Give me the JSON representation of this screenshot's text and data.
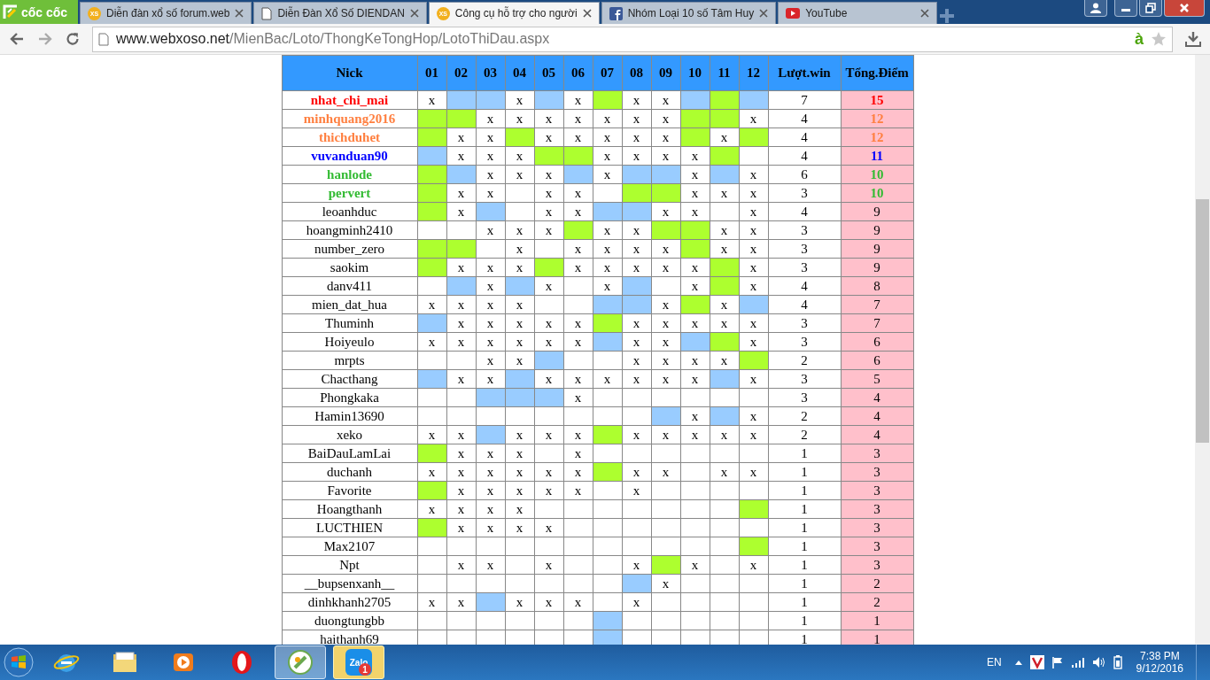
{
  "browser": {
    "brand": "cốc cốc",
    "tabs": [
      {
        "title": "Diễn đàn xổ số forum.web",
        "kind": "xs",
        "icon_text": "XS",
        "selected": false
      },
      {
        "title": "Diễn Đàn Xổ Số DIENDAN",
        "kind": "page",
        "selected": false
      },
      {
        "title": "Công cụ hỗ trợ cho người",
        "kind": "xs",
        "icon_text": "XS",
        "selected": true
      },
      {
        "title": "Nhóm Loại 10 số Tâm Huy",
        "kind": "facebook",
        "selected": false
      },
      {
        "title": "YouTube",
        "kind": "youtube",
        "selected": false
      }
    ],
    "url_host": "www.webxoso.net",
    "url_path": "/MienBac/Loto/ThongKeTongHop/LotoThiDau.aspx",
    "omnibox_mark": "à"
  },
  "table": {
    "columns": [
      "Nick",
      "01",
      "02",
      "03",
      "04",
      "05",
      "06",
      "07",
      "08",
      "09",
      "10",
      "11",
      "12",
      "Lượt.win",
      "Tổng.Điểm"
    ],
    "rows": [
      {
        "cells": [
          {
            "kind": "nick",
            "text": "nhat_chi_mai",
            "color": "#ff0000"
          },
          {
            "kind": "mark",
            "text": "x"
          },
          {
            "kind": "fill",
            "color": "#99ccff"
          },
          {
            "kind": "fill",
            "color": "#99ccff"
          },
          {
            "kind": "mark",
            "text": "x"
          },
          {
            "kind": "fill",
            "color": "#99ccff"
          },
          {
            "kind": "mark",
            "text": "x"
          },
          {
            "kind": "fill",
            "color": "#adff2f"
          },
          {
            "kind": "mark",
            "text": "x"
          },
          {
            "kind": "mark",
            "text": "x"
          },
          {
            "kind": "fill",
            "color": "#99ccff"
          },
          {
            "kind": "fill",
            "color": "#adff2f"
          },
          {
            "kind": "fill",
            "color": "#99ccff"
          },
          {
            "kind": "wins",
            "text": "7"
          },
          {
            "kind": "points",
            "text": "15",
            "color": "#ff0000"
          }
        ]
      },
      {
        "cells": [
          {
            "kind": "nick",
            "text": "minhquang2016",
            "color": "#ff7f3f"
          },
          {
            "kind": "fill",
            "color": "#adff2f"
          },
          {
            "kind": "fill",
            "color": "#adff2f"
          },
          {
            "kind": "mark",
            "text": "x"
          },
          {
            "kind": "mark",
            "text": "x"
          },
          {
            "kind": "mark",
            "text": "x"
          },
          {
            "kind": "mark",
            "text": "x"
          },
          {
            "kind": "mark",
            "text": "x"
          },
          {
            "kind": "mark",
            "text": "x"
          },
          {
            "kind": "mark",
            "text": "x"
          },
          {
            "kind": "fill",
            "color": "#adff2f"
          },
          {
            "kind": "fill",
            "color": "#adff2f"
          },
          {
            "kind": "mark",
            "text": "x"
          },
          {
            "kind": "wins",
            "text": "4"
          },
          {
            "kind": "points",
            "text": "12",
            "color": "#ff7f3f"
          }
        ]
      },
      {
        "cells": [
          {
            "kind": "nick",
            "text": "thichduhet",
            "color": "#ff7f3f"
          },
          {
            "kind": "fill",
            "color": "#adff2f"
          },
          {
            "kind": "mark",
            "text": "x"
          },
          {
            "kind": "mark",
            "text": "x"
          },
          {
            "kind": "fill",
            "color": "#adff2f"
          },
          {
            "kind": "mark",
            "text": "x"
          },
          {
            "kind": "mark",
            "text": "x"
          },
          {
            "kind": "mark",
            "text": "x"
          },
          {
            "kind": "mark",
            "text": "x"
          },
          {
            "kind": "mark",
            "text": "x"
          },
          {
            "kind": "fill",
            "color": "#adff2f"
          },
          {
            "kind": "mark",
            "text": "x"
          },
          {
            "kind": "fill",
            "color": "#adff2f"
          },
          {
            "kind": "wins",
            "text": "4"
          },
          {
            "kind": "points",
            "text": "12",
            "color": "#ff7f3f"
          }
        ]
      },
      {
        "cells": [
          {
            "kind": "nick",
            "text": "vuvanduan90",
            "color": "#0000ff"
          },
          {
            "kind": "fill",
            "color": "#99ccff"
          },
          {
            "kind": "mark",
            "text": "x"
          },
          {
            "kind": "mark",
            "text": "x"
          },
          {
            "kind": "mark",
            "text": "x"
          },
          {
            "kind": "fill",
            "color": "#adff2f"
          },
          {
            "kind": "fill",
            "color": "#adff2f"
          },
          {
            "kind": "mark",
            "text": "x"
          },
          {
            "kind": "mark",
            "text": "x"
          },
          {
            "kind": "mark",
            "text": "x"
          },
          {
            "kind": "mark",
            "text": "x"
          },
          {
            "kind": "fill",
            "color": "#adff2f"
          },
          {
            "kind": "empty"
          },
          {
            "kind": "wins",
            "text": "4"
          },
          {
            "kind": "points",
            "text": "11",
            "color": "#0000ff"
          }
        ]
      },
      {
        "cells": [
          {
            "kind": "nick",
            "text": "hanlode",
            "color": "#33bb33"
          },
          {
            "kind": "fill",
            "color": "#adff2f"
          },
          {
            "kind": "fill",
            "color": "#99ccff"
          },
          {
            "kind": "mark",
            "text": "x"
          },
          {
            "kind": "mark",
            "text": "x"
          },
          {
            "kind": "mark",
            "text": "x"
          },
          {
            "kind": "fill",
            "color": "#99ccff"
          },
          {
            "kind": "mark",
            "text": "x"
          },
          {
            "kind": "fill",
            "color": "#99ccff"
          },
          {
            "kind": "fill",
            "color": "#99ccff"
          },
          {
            "kind": "mark",
            "text": "x"
          },
          {
            "kind": "fill",
            "color": "#99ccff"
          },
          {
            "kind": "mark",
            "text": "x"
          },
          {
            "kind": "wins",
            "text": "6"
          },
          {
            "kind": "points",
            "text": "10",
            "color": "#33bb33"
          }
        ]
      },
      {
        "cells": [
          {
            "kind": "nick",
            "text": "pervert",
            "color": "#33bb33"
          },
          {
            "kind": "fill",
            "color": "#adff2f"
          },
          {
            "kind": "mark",
            "text": "x"
          },
          {
            "kind": "mark",
            "text": "x"
          },
          {
            "kind": "empty"
          },
          {
            "kind": "mark",
            "text": "x"
          },
          {
            "kind": "mark",
            "text": "x"
          },
          {
            "kind": "empty"
          },
          {
            "kind": "fill",
            "color": "#adff2f"
          },
          {
            "kind": "fill",
            "color": "#adff2f"
          },
          {
            "kind": "mark",
            "text": "x"
          },
          {
            "kind": "mark",
            "text": "x"
          },
          {
            "kind": "mark",
            "text": "x"
          },
          {
            "kind": "wins",
            "text": "3"
          },
          {
            "kind": "points",
            "text": "10",
            "color": "#33bb33"
          }
        ]
      },
      {
        "cells": [
          {
            "kind": "nick",
            "text": "leoanhduc"
          },
          {
            "kind": "fill",
            "color": "#adff2f"
          },
          {
            "kind": "mark",
            "text": "x"
          },
          {
            "kind": "fill",
            "color": "#99ccff"
          },
          {
            "kind": "empty"
          },
          {
            "kind": "mark",
            "text": "x"
          },
          {
            "kind": "mark",
            "text": "x"
          },
          {
            "kind": "fill",
            "color": "#99ccff"
          },
          {
            "kind": "fill",
            "color": "#99ccff"
          },
          {
            "kind": "mark",
            "text": "x"
          },
          {
            "kind": "mark",
            "text": "x"
          },
          {
            "kind": "empty"
          },
          {
            "kind": "mark",
            "text": "x"
          },
          {
            "kind": "wins",
            "text": "4"
          },
          {
            "kind": "points",
            "text": "9"
          }
        ]
      },
      {
        "cells": [
          {
            "kind": "nick",
            "text": "hoangminh2410"
          },
          {
            "kind": "empty"
          },
          {
            "kind": "empty"
          },
          {
            "kind": "mark",
            "text": "x"
          },
          {
            "kind": "mark",
            "text": "x"
          },
          {
            "kind": "mark",
            "text": "x"
          },
          {
            "kind": "fill",
            "color": "#adff2f"
          },
          {
            "kind": "mark",
            "text": "x"
          },
          {
            "kind": "mark",
            "text": "x"
          },
          {
            "kind": "fill",
            "color": "#adff2f"
          },
          {
            "kind": "fill",
            "color": "#adff2f"
          },
          {
            "kind": "mark",
            "text": "x"
          },
          {
            "kind": "mark",
            "text": "x"
          },
          {
            "kind": "wins",
            "text": "3"
          },
          {
            "kind": "points",
            "text": "9"
          }
        ]
      },
      {
        "cells": [
          {
            "kind": "nick",
            "text": "number_zero"
          },
          {
            "kind": "fill",
            "color": "#adff2f"
          },
          {
            "kind": "fill",
            "color": "#adff2f"
          },
          {
            "kind": "empty"
          },
          {
            "kind": "mark",
            "text": "x"
          },
          {
            "kind": "empty"
          },
          {
            "kind": "mark",
            "text": "x"
          },
          {
            "kind": "mark",
            "text": "x"
          },
          {
            "kind": "mark",
            "text": "x"
          },
          {
            "kind": "mark",
            "text": "x"
          },
          {
            "kind": "fill",
            "color": "#adff2f"
          },
          {
            "kind": "mark",
            "text": "x"
          },
          {
            "kind": "mark",
            "text": "x"
          },
          {
            "kind": "wins",
            "text": "3"
          },
          {
            "kind": "points",
            "text": "9"
          }
        ]
      },
      {
        "cells": [
          {
            "kind": "nick",
            "text": "saokim"
          },
          {
            "kind": "fill",
            "color": "#adff2f"
          },
          {
            "kind": "mark",
            "text": "x"
          },
          {
            "kind": "mark",
            "text": "x"
          },
          {
            "kind": "mark",
            "text": "x"
          },
          {
            "kind": "fill",
            "color": "#adff2f"
          },
          {
            "kind": "mark",
            "text": "x"
          },
          {
            "kind": "mark",
            "text": "x"
          },
          {
            "kind": "mark",
            "text": "x"
          },
          {
            "kind": "mark",
            "text": "x"
          },
          {
            "kind": "mark",
            "text": "x"
          },
          {
            "kind": "fill",
            "color": "#adff2f"
          },
          {
            "kind": "mark",
            "text": "x"
          },
          {
            "kind": "wins",
            "text": "3"
          },
          {
            "kind": "points",
            "text": "9"
          }
        ]
      },
      {
        "cells": [
          {
            "kind": "nick",
            "text": "danv411"
          },
          {
            "kind": "empty"
          },
          {
            "kind": "fill",
            "color": "#99ccff"
          },
          {
            "kind": "mark",
            "text": "x"
          },
          {
            "kind": "fill",
            "color": "#99ccff"
          },
          {
            "kind": "mark",
            "text": "x"
          },
          {
            "kind": "empty"
          },
          {
            "kind": "mark",
            "text": "x"
          },
          {
            "kind": "fill",
            "color": "#99ccff"
          },
          {
            "kind": "empty"
          },
          {
            "kind": "mark",
            "text": "x"
          },
          {
            "kind": "fill",
            "color": "#adff2f"
          },
          {
            "kind": "mark",
            "text": "x"
          },
          {
            "kind": "wins",
            "text": "4"
          },
          {
            "kind": "points",
            "text": "8"
          }
        ]
      },
      {
        "cells": [
          {
            "kind": "nick",
            "text": "mien_dat_hua"
          },
          {
            "kind": "mark",
            "text": "x"
          },
          {
            "kind": "mark",
            "text": "x"
          },
          {
            "kind": "mark",
            "text": "x"
          },
          {
            "kind": "mark",
            "text": "x"
          },
          {
            "kind": "empty"
          },
          {
            "kind": "empty"
          },
          {
            "kind": "fill",
            "color": "#99ccff"
          },
          {
            "kind": "fill",
            "color": "#99ccff"
          },
          {
            "kind": "mark",
            "text": "x"
          },
          {
            "kind": "fill",
            "color": "#adff2f"
          },
          {
            "kind": "mark",
            "text": "x"
          },
          {
            "kind": "fill",
            "color": "#99ccff"
          },
          {
            "kind": "wins",
            "text": "4"
          },
          {
            "kind": "points",
            "text": "7"
          }
        ]
      },
      {
        "cells": [
          {
            "kind": "nick",
            "text": "Thuminh"
          },
          {
            "kind": "fill",
            "color": "#99ccff"
          },
          {
            "kind": "mark",
            "text": "x"
          },
          {
            "kind": "mark",
            "text": "x"
          },
          {
            "kind": "mark",
            "text": "x"
          },
          {
            "kind": "mark",
            "text": "x"
          },
          {
            "kind": "mark",
            "text": "x"
          },
          {
            "kind": "fill",
            "color": "#adff2f"
          },
          {
            "kind": "mark",
            "text": "x"
          },
          {
            "kind": "mark",
            "text": "x"
          },
          {
            "kind": "mark",
            "text": "x"
          },
          {
            "kind": "mark",
            "text": "x"
          },
          {
            "kind": "mark",
            "text": "x"
          },
          {
            "kind": "wins",
            "text": "3"
          },
          {
            "kind": "points",
            "text": "7"
          }
        ]
      },
      {
        "cells": [
          {
            "kind": "nick",
            "text": "Hoiyeulo"
          },
          {
            "kind": "mark",
            "text": "x"
          },
          {
            "kind": "mark",
            "text": "x"
          },
          {
            "kind": "mark",
            "text": "x"
          },
          {
            "kind": "mark",
            "text": "x"
          },
          {
            "kind": "mark",
            "text": "x"
          },
          {
            "kind": "mark",
            "text": "x"
          },
          {
            "kind": "fill",
            "color": "#99ccff"
          },
          {
            "kind": "mark",
            "text": "x"
          },
          {
            "kind": "mark",
            "text": "x"
          },
          {
            "kind": "fill",
            "color": "#99ccff"
          },
          {
            "kind": "fill",
            "color": "#adff2f"
          },
          {
            "kind": "mark",
            "text": "x"
          },
          {
            "kind": "wins",
            "text": "3"
          },
          {
            "kind": "points",
            "text": "6"
          }
        ]
      },
      {
        "cells": [
          {
            "kind": "nick",
            "text": "mrpts"
          },
          {
            "kind": "empty"
          },
          {
            "kind": "empty"
          },
          {
            "kind": "mark",
            "text": "x"
          },
          {
            "kind": "mark",
            "text": "x"
          },
          {
            "kind": "fill",
            "color": "#99ccff"
          },
          {
            "kind": "empty"
          },
          {
            "kind": "empty"
          },
          {
            "kind": "mark",
            "text": "x"
          },
          {
            "kind": "mark",
            "text": "x"
          },
          {
            "kind": "mark",
            "text": "x"
          },
          {
            "kind": "mark",
            "text": "x"
          },
          {
            "kind": "fill",
            "color": "#adff2f"
          },
          {
            "kind": "wins",
            "text": "2"
          },
          {
            "kind": "points",
            "text": "6"
          }
        ]
      },
      {
        "cells": [
          {
            "kind": "nick",
            "text": "Chacthang"
          },
          {
            "kind": "fill",
            "color": "#99ccff"
          },
          {
            "kind": "mark",
            "text": "x"
          },
          {
            "kind": "mark",
            "text": "x"
          },
          {
            "kind": "fill",
            "color": "#99ccff"
          },
          {
            "kind": "mark",
            "text": "x"
          },
          {
            "kind": "mark",
            "text": "x"
          },
          {
            "kind": "mark",
            "text": "x"
          },
          {
            "kind": "mark",
            "text": "x"
          },
          {
            "kind": "mark",
            "text": "x"
          },
          {
            "kind": "mark",
            "text": "x"
          },
          {
            "kind": "fill",
            "color": "#99ccff"
          },
          {
            "kind": "mark",
            "text": "x"
          },
          {
            "kind": "wins",
            "text": "3"
          },
          {
            "kind": "points",
            "text": "5"
          }
        ]
      },
      {
        "cells": [
          {
            "kind": "nick",
            "text": "Phongkaka"
          },
          {
            "kind": "empty"
          },
          {
            "kind": "empty"
          },
          {
            "kind": "fill",
            "color": "#99ccff"
          },
          {
            "kind": "fill",
            "color": "#99ccff"
          },
          {
            "kind": "fill",
            "color": "#99ccff"
          },
          {
            "kind": "mark",
            "text": "x"
          },
          {
            "kind": "empty"
          },
          {
            "kind": "empty"
          },
          {
            "kind": "empty"
          },
          {
            "kind": "empty"
          },
          {
            "kind": "empty"
          },
          {
            "kind": "empty"
          },
          {
            "kind": "wins",
            "text": "3"
          },
          {
            "kind": "points",
            "text": "4"
          }
        ]
      },
      {
        "cells": [
          {
            "kind": "nick",
            "text": "Hamin13690"
          },
          {
            "kind": "empty"
          },
          {
            "kind": "empty"
          },
          {
            "kind": "empty"
          },
          {
            "kind": "empty"
          },
          {
            "kind": "empty"
          },
          {
            "kind": "empty"
          },
          {
            "kind": "empty"
          },
          {
            "kind": "empty"
          },
          {
            "kind": "fill",
            "color": "#99ccff"
          },
          {
            "kind": "mark",
            "text": "x"
          },
          {
            "kind": "fill",
            "color": "#99ccff"
          },
          {
            "kind": "mark",
            "text": "x"
          },
          {
            "kind": "wins",
            "text": "2"
          },
          {
            "kind": "points",
            "text": "4"
          }
        ]
      },
      {
        "cells": [
          {
            "kind": "nick",
            "text": "xeko"
          },
          {
            "kind": "mark",
            "text": "x"
          },
          {
            "kind": "mark",
            "text": "x"
          },
          {
            "kind": "fill",
            "color": "#99ccff"
          },
          {
            "kind": "mark",
            "text": "x"
          },
          {
            "kind": "mark",
            "text": "x"
          },
          {
            "kind": "mark",
            "text": "x"
          },
          {
            "kind": "fill",
            "color": "#adff2f"
          },
          {
            "kind": "mark",
            "text": "x"
          },
          {
            "kind": "mark",
            "text": "x"
          },
          {
            "kind": "mark",
            "text": "x"
          },
          {
            "kind": "mark",
            "text": "x"
          },
          {
            "kind": "mark",
            "text": "x"
          },
          {
            "kind": "wins",
            "text": "2"
          },
          {
            "kind": "points",
            "text": "4"
          }
        ]
      },
      {
        "cells": [
          {
            "kind": "nick",
            "text": "BaiDauLamLai"
          },
          {
            "kind": "fill",
            "color": "#adff2f"
          },
          {
            "kind": "mark",
            "text": "x"
          },
          {
            "kind": "mark",
            "text": "x"
          },
          {
            "kind": "mark",
            "text": "x"
          },
          {
            "kind": "empty"
          },
          {
            "kind": "mark",
            "text": "x"
          },
          {
            "kind": "empty"
          },
          {
            "kind": "empty"
          },
          {
            "kind": "empty"
          },
          {
            "kind": "empty"
          },
          {
            "kind": "empty"
          },
          {
            "kind": "empty"
          },
          {
            "kind": "wins",
            "text": "1"
          },
          {
            "kind": "points",
            "text": "3"
          }
        ]
      },
      {
        "cells": [
          {
            "kind": "nick",
            "text": "duchanh"
          },
          {
            "kind": "mark",
            "text": "x"
          },
          {
            "kind": "mark",
            "text": "x"
          },
          {
            "kind": "mark",
            "text": "x"
          },
          {
            "kind": "mark",
            "text": "x"
          },
          {
            "kind": "mark",
            "text": "x"
          },
          {
            "kind": "mark",
            "text": "x"
          },
          {
            "kind": "fill",
            "color": "#adff2f"
          },
          {
            "kind": "mark",
            "text": "x"
          },
          {
            "kind": "mark",
            "text": "x"
          },
          {
            "kind": "empty"
          },
          {
            "kind": "mark",
            "text": "x"
          },
          {
            "kind": "mark",
            "text": "x"
          },
          {
            "kind": "wins",
            "text": "1"
          },
          {
            "kind": "points",
            "text": "3"
          }
        ]
      },
      {
        "cells": [
          {
            "kind": "nick",
            "text": "Favorite"
          },
          {
            "kind": "fill",
            "color": "#adff2f"
          },
          {
            "kind": "mark",
            "text": "x"
          },
          {
            "kind": "mark",
            "text": "x"
          },
          {
            "kind": "mark",
            "text": "x"
          },
          {
            "kind": "mark",
            "text": "x"
          },
          {
            "kind": "mark",
            "text": "x"
          },
          {
            "kind": "empty"
          },
          {
            "kind": "mark",
            "text": "x"
          },
          {
            "kind": "empty"
          },
          {
            "kind": "empty"
          },
          {
            "kind": "empty"
          },
          {
            "kind": "empty"
          },
          {
            "kind": "wins",
            "text": "1"
          },
          {
            "kind": "points",
            "text": "3"
          }
        ]
      },
      {
        "cells": [
          {
            "kind": "nick",
            "text": "Hoangthanh"
          },
          {
            "kind": "mark",
            "text": "x"
          },
          {
            "kind": "mark",
            "text": "x"
          },
          {
            "kind": "mark",
            "text": "x"
          },
          {
            "kind": "mark",
            "text": "x"
          },
          {
            "kind": "empty"
          },
          {
            "kind": "empty"
          },
          {
            "kind": "empty"
          },
          {
            "kind": "empty"
          },
          {
            "kind": "empty"
          },
          {
            "kind": "empty"
          },
          {
            "kind": "empty"
          },
          {
            "kind": "fill",
            "color": "#adff2f"
          },
          {
            "kind": "wins",
            "text": "1"
          },
          {
            "kind": "points",
            "text": "3"
          }
        ]
      },
      {
        "cells": [
          {
            "kind": "nick",
            "text": "LUCTHIEN"
          },
          {
            "kind": "fill",
            "color": "#adff2f"
          },
          {
            "kind": "mark",
            "text": "x"
          },
          {
            "kind": "mark",
            "text": "x"
          },
          {
            "kind": "mark",
            "text": "x"
          },
          {
            "kind": "mark",
            "text": "x"
          },
          {
            "kind": "empty"
          },
          {
            "kind": "empty"
          },
          {
            "kind": "empty"
          },
          {
            "kind": "empty"
          },
          {
            "kind": "empty"
          },
          {
            "kind": "empty"
          },
          {
            "kind": "empty"
          },
          {
            "kind": "wins",
            "text": "1"
          },
          {
            "kind": "points",
            "text": "3"
          }
        ]
      },
      {
        "cells": [
          {
            "kind": "nick",
            "text": "Max2107"
          },
          {
            "kind": "empty"
          },
          {
            "kind": "empty"
          },
          {
            "kind": "empty"
          },
          {
            "kind": "empty"
          },
          {
            "kind": "empty"
          },
          {
            "kind": "empty"
          },
          {
            "kind": "empty"
          },
          {
            "kind": "empty"
          },
          {
            "kind": "empty"
          },
          {
            "kind": "empty"
          },
          {
            "kind": "empty"
          },
          {
            "kind": "fill",
            "color": "#adff2f"
          },
          {
            "kind": "wins",
            "text": "1"
          },
          {
            "kind": "points",
            "text": "3"
          }
        ]
      },
      {
        "cells": [
          {
            "kind": "nick",
            "text": "Npt"
          },
          {
            "kind": "empty"
          },
          {
            "kind": "mark",
            "text": "x"
          },
          {
            "kind": "mark",
            "text": "x"
          },
          {
            "kind": "empty"
          },
          {
            "kind": "mark",
            "text": "x"
          },
          {
            "kind": "empty"
          },
          {
            "kind": "empty"
          },
          {
            "kind": "mark",
            "text": "x"
          },
          {
            "kind": "fill",
            "color": "#adff2f"
          },
          {
            "kind": "mark",
            "text": "x"
          },
          {
            "kind": "empty"
          },
          {
            "kind": "mark",
            "text": "x"
          },
          {
            "kind": "wins",
            "text": "1"
          },
          {
            "kind": "points",
            "text": "3"
          }
        ]
      },
      {
        "cells": [
          {
            "kind": "nick",
            "text": "__bupsenxanh__"
          },
          {
            "kind": "empty"
          },
          {
            "kind": "empty"
          },
          {
            "kind": "empty"
          },
          {
            "kind": "empty"
          },
          {
            "kind": "empty"
          },
          {
            "kind": "empty"
          },
          {
            "kind": "empty"
          },
          {
            "kind": "fill",
            "color": "#99ccff"
          },
          {
            "kind": "mark",
            "text": "x"
          },
          {
            "kind": "empty"
          },
          {
            "kind": "empty"
          },
          {
            "kind": "empty"
          },
          {
            "kind": "wins",
            "text": "1"
          },
          {
            "kind": "points",
            "text": "2"
          }
        ]
      },
      {
        "cells": [
          {
            "kind": "nick",
            "text": "dinhkhanh2705"
          },
          {
            "kind": "mark",
            "text": "x"
          },
          {
            "kind": "mark",
            "text": "x"
          },
          {
            "kind": "fill",
            "color": "#99ccff"
          },
          {
            "kind": "mark",
            "text": "x"
          },
          {
            "kind": "mark",
            "text": "x"
          },
          {
            "kind": "mark",
            "text": "x"
          },
          {
            "kind": "empty"
          },
          {
            "kind": "mark",
            "text": "x"
          },
          {
            "kind": "empty"
          },
          {
            "kind": "empty"
          },
          {
            "kind": "empty"
          },
          {
            "kind": "empty"
          },
          {
            "kind": "wins",
            "text": "1"
          },
          {
            "kind": "points",
            "text": "2"
          }
        ]
      },
      {
        "cells": [
          {
            "kind": "nick",
            "text": "duongtungbb"
          },
          {
            "kind": "empty"
          },
          {
            "kind": "empty"
          },
          {
            "kind": "empty"
          },
          {
            "kind": "empty"
          },
          {
            "kind": "empty"
          },
          {
            "kind": "empty"
          },
          {
            "kind": "fill",
            "color": "#99ccff"
          },
          {
            "kind": "empty"
          },
          {
            "kind": "empty"
          },
          {
            "kind": "empty"
          },
          {
            "kind": "empty"
          },
          {
            "kind": "empty"
          },
          {
            "kind": "wins",
            "text": "1"
          },
          {
            "kind": "points",
            "text": "1"
          }
        ]
      },
      {
        "cells": [
          {
            "kind": "nick",
            "text": "haithanh69"
          },
          {
            "kind": "empty"
          },
          {
            "kind": "empty"
          },
          {
            "kind": "empty"
          },
          {
            "kind": "empty"
          },
          {
            "kind": "empty"
          },
          {
            "kind": "empty"
          },
          {
            "kind": "fill",
            "color": "#99ccff"
          },
          {
            "kind": "empty"
          },
          {
            "kind": "empty"
          },
          {
            "kind": "empty"
          },
          {
            "kind": "empty"
          },
          {
            "kind": "empty"
          },
          {
            "kind": "wins",
            "text": "1"
          },
          {
            "kind": "points",
            "text": "1"
          }
        ]
      }
    ]
  },
  "taskbar": {
    "apps": [
      {
        "kind": "ie",
        "active": false,
        "flashing": false
      },
      {
        "kind": "folder",
        "active": false,
        "flashing": false
      },
      {
        "kind": "media",
        "active": false,
        "flashing": false
      },
      {
        "kind": "opera",
        "active": false,
        "flashing": false
      },
      {
        "kind": "coccoc",
        "active": true,
        "flashing": false
      },
      {
        "kind": "zalo",
        "active": false,
        "flashing": true,
        "label": "Zalo",
        "badge": "1"
      }
    ],
    "language": "EN",
    "time": "7:38 PM",
    "date": "9/12/2016"
  }
}
